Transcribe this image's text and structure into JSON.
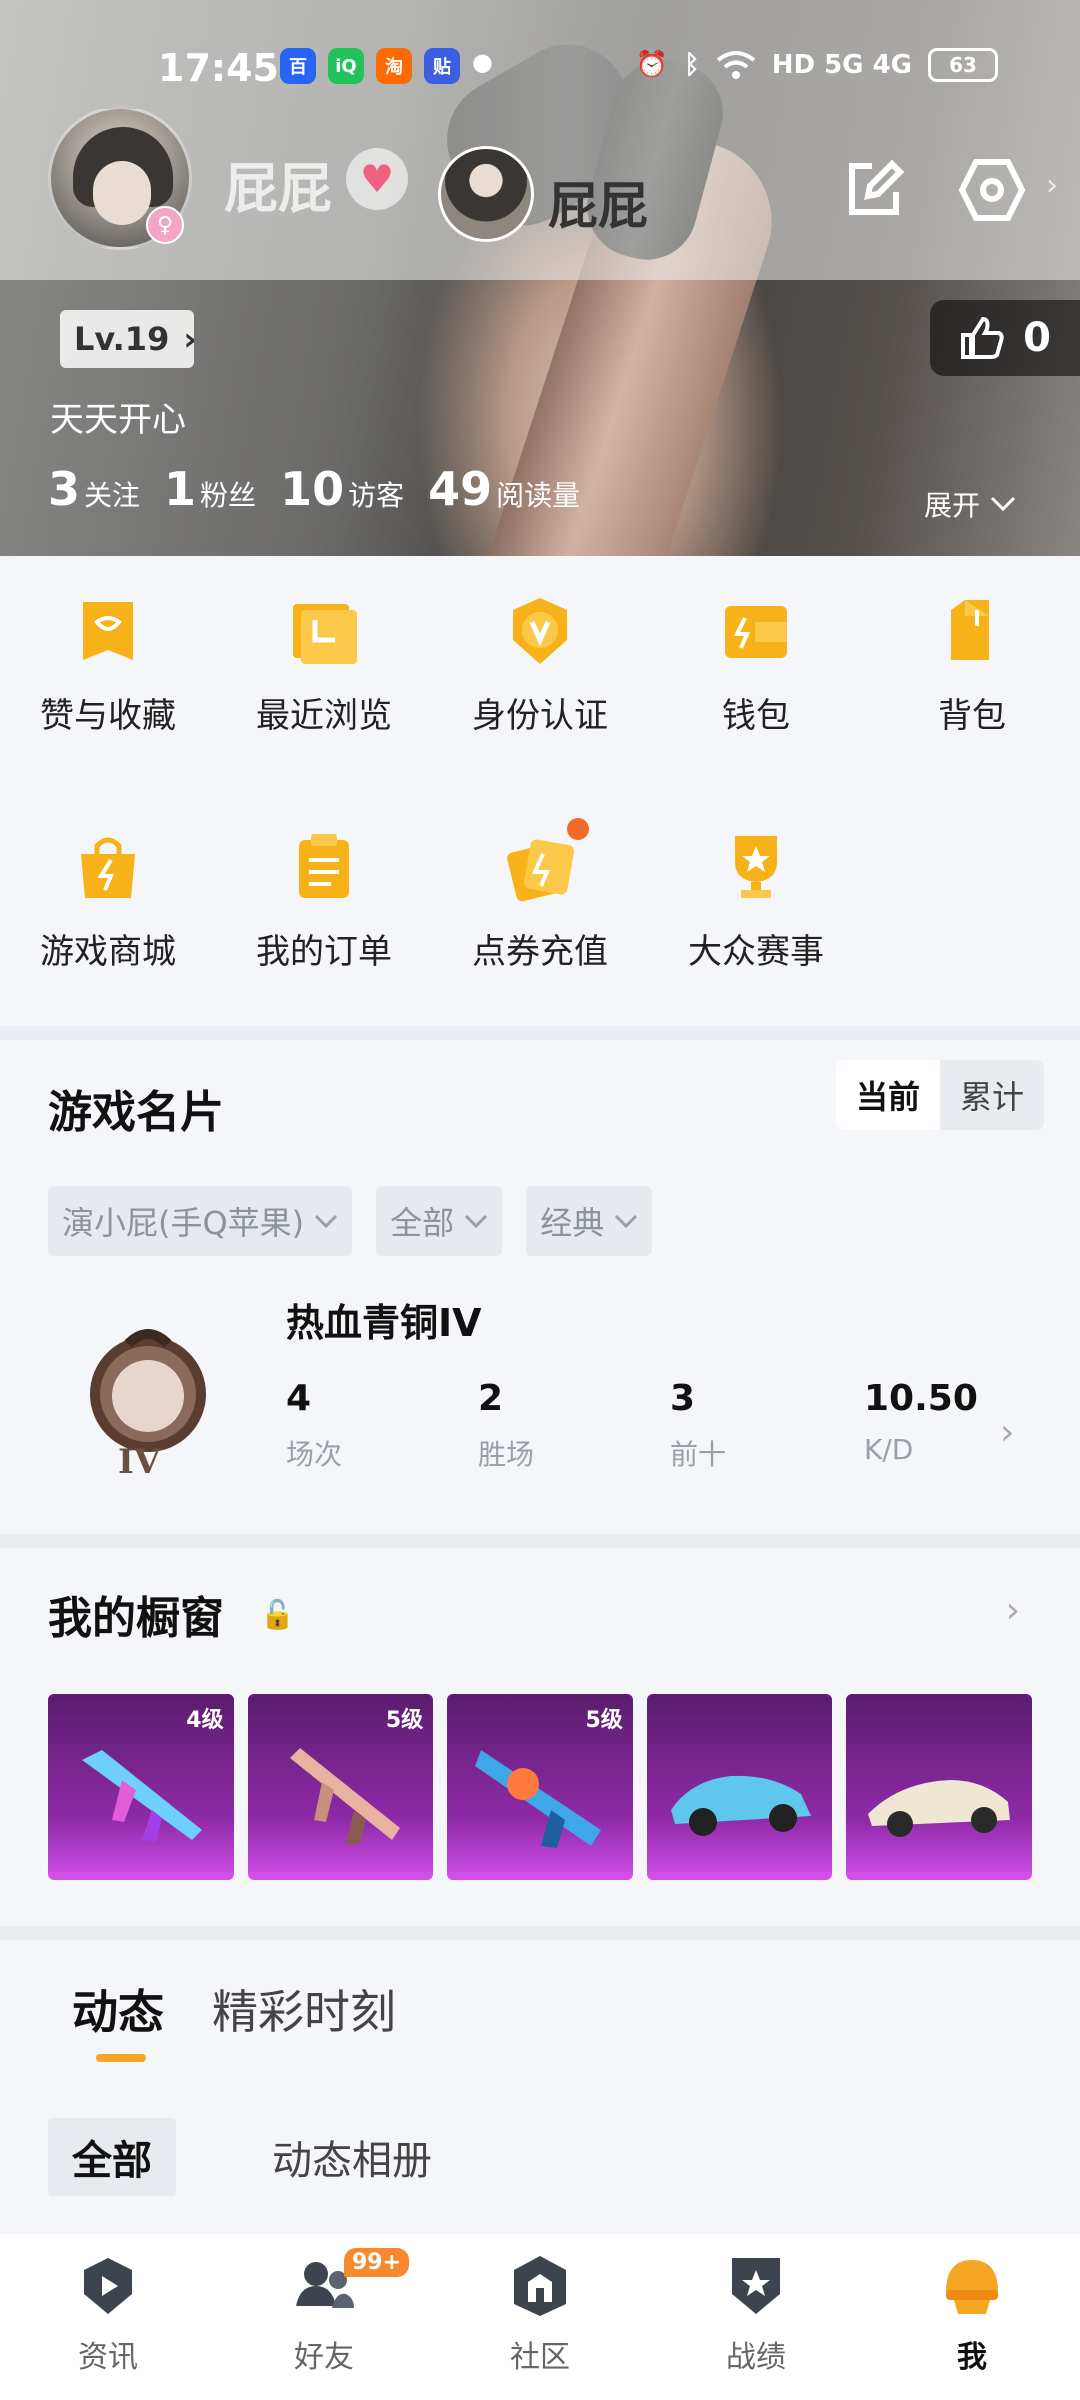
{
  "status_bar": {
    "time": "17:45",
    "apps": [
      {
        "icon": "baidu-icon",
        "text": "百",
        "color": "#2a64f5"
      },
      {
        "icon": "iqiyi-icon",
        "text": "iQ",
        "color": "#22c35d"
      },
      {
        "icon": "taobao-icon",
        "text": "淘",
        "color": "#ff6a00"
      },
      {
        "icon": "tieba-icon",
        "text": "贴",
        "color": "#3b5fe0"
      }
    ],
    "network": "HD 5G 4G",
    "battery": "63"
  },
  "profile": {
    "name_faded": "屁屁",
    "name": "屁屁",
    "level": "Lv.19",
    "motto": "天天开心",
    "likes": "0",
    "stats": [
      {
        "num": "3",
        "label": "关注"
      },
      {
        "num": "1",
        "label": "粉丝"
      },
      {
        "num": "10",
        "label": "访客"
      },
      {
        "num": "49",
        "label": "阅读量"
      }
    ],
    "expand_label": "展开"
  },
  "grid": {
    "row1": [
      {
        "label": "赞与收藏",
        "icon": "heart-bookmark-icon"
      },
      {
        "label": "最近浏览",
        "icon": "history-icon"
      },
      {
        "label": "身份认证",
        "icon": "verify-icon"
      },
      {
        "label": "钱包",
        "icon": "wallet-icon"
      },
      {
        "label": "背包",
        "icon": "backpack-icon"
      }
    ],
    "row2": [
      {
        "label": "游戏商城",
        "icon": "shop-bag-icon"
      },
      {
        "label": "我的订单",
        "icon": "order-icon"
      },
      {
        "label": "点券充值",
        "icon": "recharge-icon"
      },
      {
        "label": "大众赛事",
        "icon": "trophy-icon"
      }
    ]
  },
  "game_card": {
    "title": "游戏名片",
    "toggle": [
      "当前",
      "累计"
    ],
    "filters": [
      "演小屁(手Q苹果)",
      "全部",
      "经典"
    ],
    "rank_name": "热血青铜IV",
    "rank_tier": "IV",
    "metrics": [
      {
        "value": "4",
        "label": "场次"
      },
      {
        "value": "2",
        "label": "胜场"
      },
      {
        "value": "3",
        "label": "前十"
      },
      {
        "value": "10.50",
        "label": "K/D"
      }
    ]
  },
  "showcase": {
    "title": "我的橱窗",
    "items": [
      {
        "level": "4级",
        "kind": "rifle-skin-1"
      },
      {
        "level": "5级",
        "kind": "rifle-skin-2"
      },
      {
        "level": "5级",
        "kind": "blaster-skin"
      },
      {
        "level": "",
        "kind": "car-blue"
      },
      {
        "level": "",
        "kind": "car-white"
      }
    ]
  },
  "feed": {
    "tabs": [
      "动态",
      "精彩时刻"
    ],
    "subtabs": [
      "全部",
      "动态相册"
    ]
  },
  "nav": [
    {
      "label": "资讯",
      "icon": "news-play-icon"
    },
    {
      "label": "好友",
      "icon": "friends-icon",
      "badge": "99+"
    },
    {
      "label": "社区",
      "icon": "community-icon"
    },
    {
      "label": "战绩",
      "icon": "record-shield-icon"
    },
    {
      "label": "我",
      "icon": "helmet-icon"
    }
  ],
  "colors": {
    "accent": "#f5a623",
    "badge": "#f6892e",
    "item_purple": "#8e2aa7"
  }
}
